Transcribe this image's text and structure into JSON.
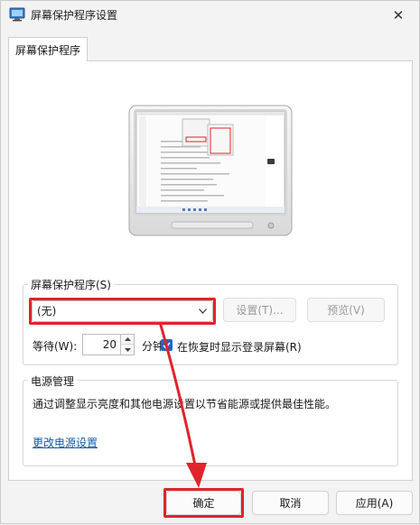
{
  "window": {
    "title": "屏幕保护程序设置",
    "close_glyph": "✕"
  },
  "tabs": [
    {
      "label": "屏幕保护程序"
    }
  ],
  "screensaver": {
    "group_label": "屏幕保护程序(S)",
    "selected_value": "(无)",
    "settings_button": "设置(T)...",
    "preview_button": "预览(V)",
    "wait_label": "等待(W):",
    "wait_value": "20",
    "wait_unit": "分钟",
    "resume_checkbox_label": "在恢复时显示登录屏幕(R)",
    "resume_checked": true
  },
  "power": {
    "group_label": "电源管理",
    "description": "通过调整显示亮度和其他电源设置以节省能源或提供最佳性能。",
    "link": "更改电源设置"
  },
  "footer": {
    "ok_button": "确定",
    "cancel_button": "取消",
    "apply_button": "应用(A)"
  },
  "colors": {
    "accent": "#1e66c6",
    "highlight_red": "#e0242b",
    "link": "#0f5da8"
  },
  "icons": [
    "screensaver-app-icon",
    "close-icon",
    "chevron-down-icon",
    "spin-up-icon",
    "spin-down-icon",
    "checkmark-icon",
    "monitor-preview-icon"
  ]
}
